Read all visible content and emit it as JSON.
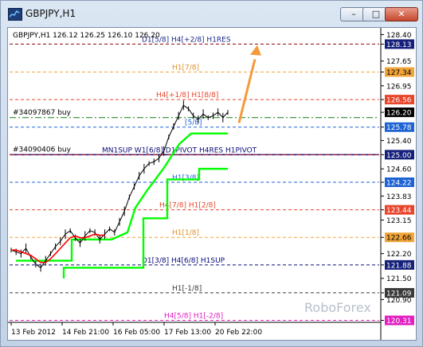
{
  "window": {
    "title": "GBPJPY,H1",
    "minimize_label": "–",
    "maximize_label": "□",
    "close_label": "✕"
  },
  "chart": {
    "info": "GBPJPY,H1  126.12 126.25 126.10 126.20",
    "watermark": "RoboForex",
    "colors": {
      "price_line": "#000000",
      "ma_red": "#ff0000",
      "support_green": "#00ff00",
      "arrow": "#f59a3c",
      "price_badge_blue": "#1e63d3",
      "price_badge_orange": "#f0a43a",
      "price_badge_red": "#e8452b"
    }
  },
  "chart_data": {
    "type": "line",
    "symbol": "GBPJPY",
    "timeframe": "H1",
    "ohlc": {
      "open": 126.12,
      "high": 126.25,
      "low": 126.1,
      "close": 126.2
    },
    "ylim": [
      120.3,
      128.5
    ],
    "x_ticks": [
      "13 Feb 2012",
      "14 Feb 21:00",
      "16 Feb 05:00",
      "17 Feb 13:00",
      "20 Feb 22:00"
    ],
    "price_axis": [
      {
        "value": "128.40",
        "style": "plain"
      },
      {
        "value": "128.13",
        "style": "navy"
      },
      {
        "value": "127.65",
        "style": "plain"
      },
      {
        "value": "127.34",
        "style": "orange"
      },
      {
        "value": "126.95",
        "style": "plain"
      },
      {
        "value": "126.56",
        "style": "red"
      },
      {
        "value": "126.20",
        "style": "black"
      },
      {
        "value": "125.78",
        "style": "blue"
      },
      {
        "value": "125.40",
        "style": "plain"
      },
      {
        "value": "125.00",
        "style": "navy"
      },
      {
        "value": "124.60",
        "style": "plain"
      },
      {
        "value": "124.22",
        "style": "blue"
      },
      {
        "value": "123.83",
        "style": "plain"
      },
      {
        "value": "123.44",
        "style": "red"
      },
      {
        "value": "123.15",
        "style": "plain"
      },
      {
        "value": "122.66",
        "style": "orange"
      },
      {
        "value": "122.20",
        "style": "plain"
      },
      {
        "value": "121.88",
        "style": "navy"
      },
      {
        "value": "121.50",
        "style": "plain"
      },
      {
        "value": "121.09",
        "style": "gray"
      },
      {
        "value": "120.90",
        "style": "plain"
      },
      {
        "value": "120.31",
        "style": "magenta"
      }
    ],
    "levels": [
      {
        "label": "D1[5/8] H4[+2/8] H1RES",
        "value": 128.13,
        "color": "#8b0000",
        "dash": "4,3",
        "label_color": "#1b2a8a"
      },
      {
        "label": "H1[7/8]",
        "value": 127.34,
        "color": "#f0a43a",
        "dash": "4,3",
        "label_color": "#e0902a"
      },
      {
        "label": "H4[+1/8] H1[8/8]",
        "value": 126.56,
        "color": "#e8452b",
        "dash": "4,3",
        "label_color": "#e8452b"
      },
      {
        "label": "[5/8]",
        "value": 125.78,
        "color": "#1e63d3",
        "dash": "4,3",
        "label_color": "#1e63d3"
      },
      {
        "label": "MN1SUP W1[6/8] D1PIVOT H4RES H1PIVOT",
        "value": 125.0,
        "color": "#0a0a7a",
        "dash": "",
        "label_color": "#0a0a7a"
      },
      {
        "label": "H1[3/8]",
        "value": 124.22,
        "color": "#1e63d3",
        "dash": "4,3",
        "label_color": "#1e63d3"
      },
      {
        "label": "H4[7/8] H1[2/8]",
        "value": 123.44,
        "color": "#e8452b",
        "dash": "4,3",
        "label_color": "#e8452b"
      },
      {
        "label": "H1[1/8]",
        "value": 122.66,
        "color": "#f0a43a",
        "dash": "4,3",
        "label_color": "#e0902a"
      },
      {
        "label": "D1[3/8] H4[6/8] H1SUP",
        "value": 121.88,
        "color": "#0a0a7a",
        "dash": "4,3",
        "label_color": "#0a0a7a"
      },
      {
        "label": "H1[-1/8]",
        "value": 121.09,
        "color": "#3a3a3a",
        "dash": "4,3",
        "label_color": "#3a3a3a"
      },
      {
        "label": "H4[5/8] H1[-2/8]",
        "value": 120.31,
        "color": "#e020c0",
        "dash": "4,3",
        "label_color": "#e020c0"
      }
    ],
    "orders": [
      {
        "label": "#34097867 buy",
        "value": 126.05,
        "color": "#1a7a1a"
      },
      {
        "label": "#34090406 buy",
        "value": 125.0,
        "color": "#d0202a"
      }
    ],
    "price_series": [
      122.3,
      122.25,
      122.2,
      122.35,
      122.1,
      121.9,
      121.8,
      122.0,
      122.2,
      122.4,
      122.55,
      122.75,
      122.85,
      122.65,
      122.5,
      122.7,
      122.85,
      122.8,
      122.6,
      122.75,
      122.9,
      122.8,
      123.1,
      123.4,
      123.8,
      124.1,
      124.4,
      124.6,
      124.75,
      124.8,
      124.9,
      125.1,
      125.5,
      125.8,
      126.1,
      126.4,
      126.3,
      126.1,
      126.0,
      126.15,
      126.05,
      126.1,
      126.2,
      126.05,
      126.2
    ],
    "red_ma": [
      122.3,
      122.3,
      122.25,
      122.2,
      122.15,
      122.05,
      121.95,
      121.95,
      122.05,
      122.2,
      122.35,
      122.5,
      122.65,
      122.7,
      122.65,
      122.65,
      122.7,
      122.75,
      122.72,
      122.72
    ]
  }
}
